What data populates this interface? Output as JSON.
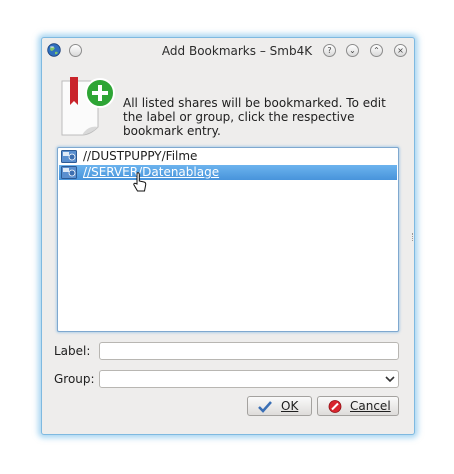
{
  "window": {
    "title": "Add Bookmarks – Smb4K"
  },
  "titlebar_buttons": {
    "help": "?",
    "minimize": "⌄",
    "maximize": "⌃",
    "close": "×"
  },
  "info_text": "All listed shares will be bookmarked. To edit the label or group, click the respective bookmark entry.",
  "shares": [
    {
      "label": "//DUSTPUPPY/Filme",
      "selected": false
    },
    {
      "label": "//SERVER/Datenablage",
      "selected": true
    }
  ],
  "form": {
    "label_caption": "Label:",
    "label_value": "",
    "group_caption": "Group:",
    "group_value": ""
  },
  "buttons": {
    "ok": "OK",
    "cancel": "Cancel"
  },
  "colors": {
    "selection": "#4894db",
    "window_bg": "#eeedec",
    "glow": "#7fb9e0"
  }
}
